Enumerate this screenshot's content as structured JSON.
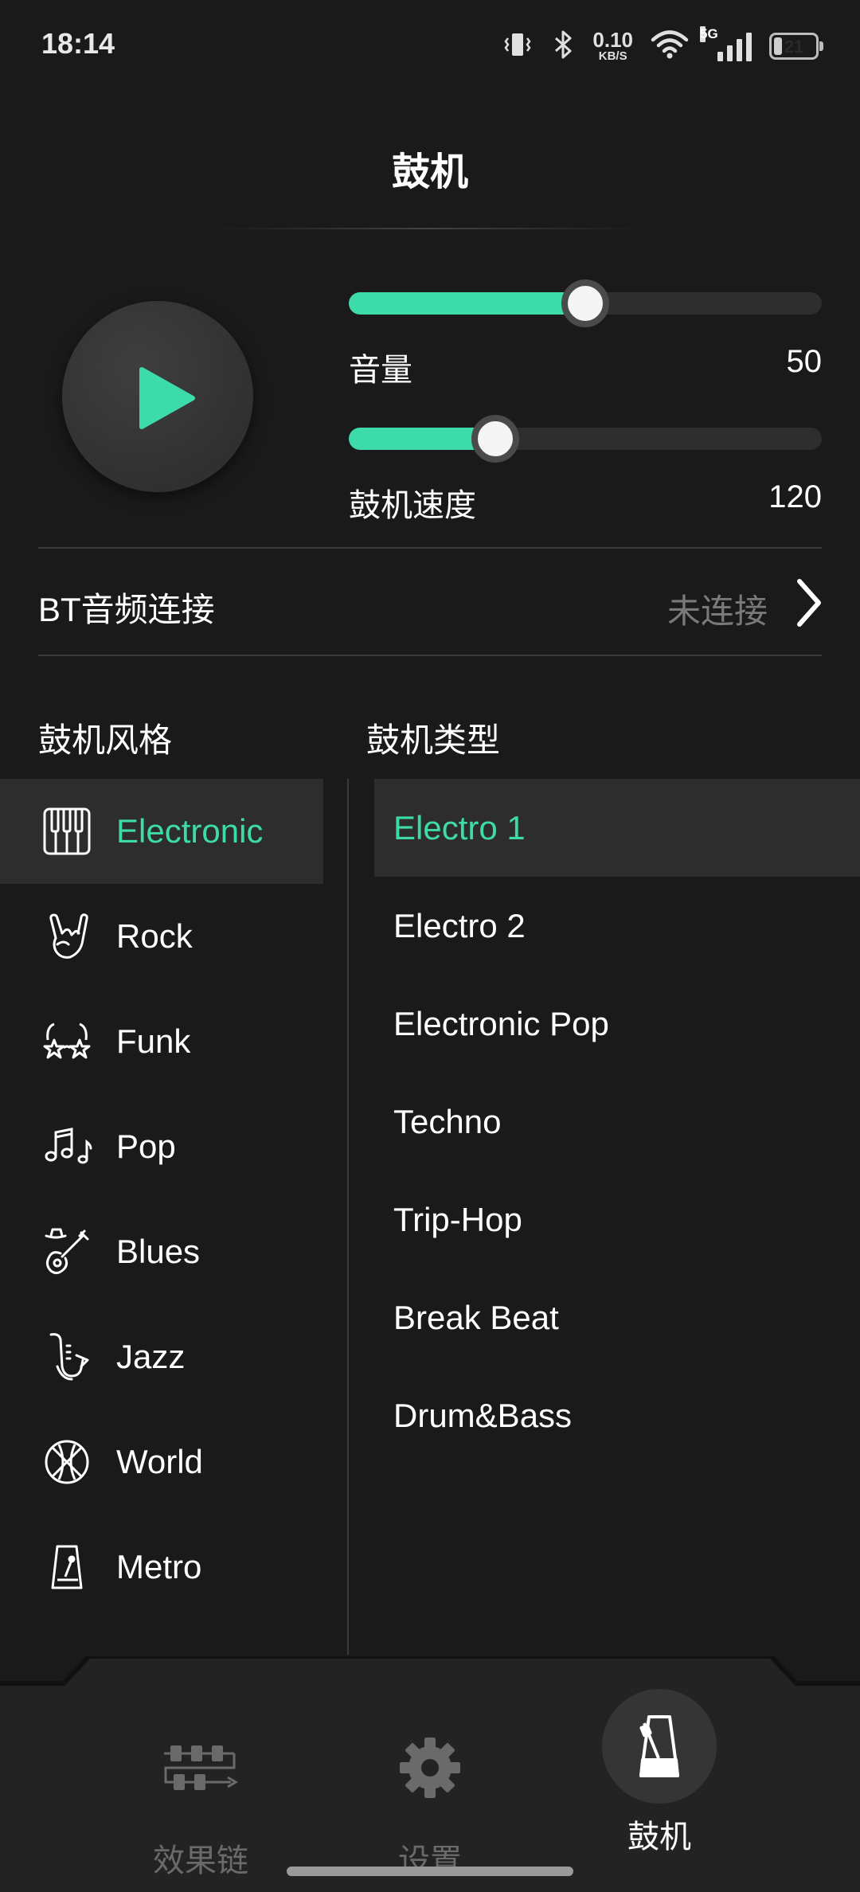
{
  "status_bar": {
    "time": "18:14",
    "net_speed_value": "0.10",
    "net_speed_unit": "KB/S",
    "signal_type": "5G",
    "battery": "21",
    "battery_level": 0.21
  },
  "header": {
    "title": "鼓机"
  },
  "controls": {
    "volume": {
      "label": "音量",
      "value": "50",
      "fraction": 0.5
    },
    "tempo": {
      "label": "鼓机速度",
      "value": "120",
      "fraction": 0.31
    }
  },
  "bt": {
    "label": "BT音频连接",
    "status": "未连接"
  },
  "columns": {
    "style_header": "鼓机风格",
    "type_header": "鼓机类型"
  },
  "styles": [
    {
      "label": "Electronic",
      "icon": "piano-keys-icon",
      "active": true
    },
    {
      "label": "Rock",
      "icon": "rock-hand-icon",
      "active": false
    },
    {
      "label": "Funk",
      "icon": "funk-glasses-icon",
      "active": false
    },
    {
      "label": "Pop",
      "icon": "music-notes-icon",
      "active": false
    },
    {
      "label": "Blues",
      "icon": "guitar-hat-icon",
      "active": false
    },
    {
      "label": "Jazz",
      "icon": "saxophone-icon",
      "active": false
    },
    {
      "label": "World",
      "icon": "globe-icon",
      "active": false
    },
    {
      "label": "Metro",
      "icon": "metronome-icon",
      "active": false
    }
  ],
  "types": [
    {
      "label": "Electro 1",
      "active": true
    },
    {
      "label": "Electro 2",
      "active": false
    },
    {
      "label": "Electronic Pop",
      "active": false
    },
    {
      "label": "Techno",
      "active": false
    },
    {
      "label": "Trip-Hop",
      "active": false
    },
    {
      "label": "Break Beat",
      "active": false
    },
    {
      "label": "Drum&Bass",
      "active": false
    }
  ],
  "nav": [
    {
      "label": "效果链",
      "icon": "effects-chain-icon",
      "active": false
    },
    {
      "label": "设置",
      "icon": "gear-icon",
      "active": false
    },
    {
      "label": "鼓机",
      "icon": "metronome-icon",
      "active": true
    }
  ],
  "colors": {
    "accent": "#3ddba9",
    "background": "#1a1a1a",
    "inactive_text": "#6a6a6a"
  }
}
